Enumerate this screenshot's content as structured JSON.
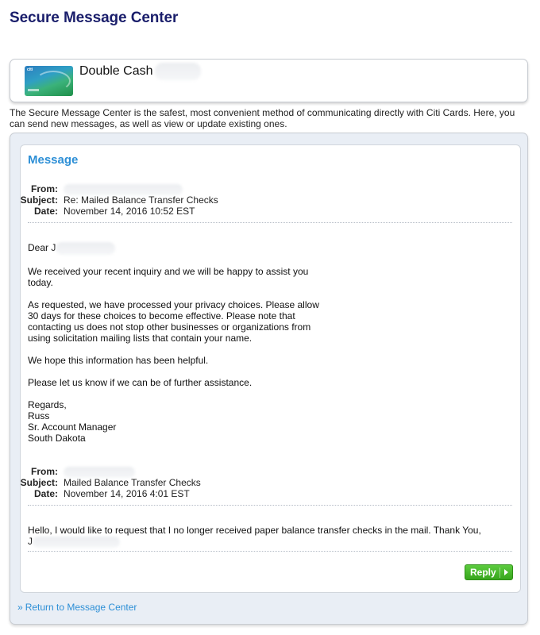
{
  "page": {
    "title": "Secure Message Center"
  },
  "card": {
    "name": "Double Cash",
    "image_logo": "citi"
  },
  "intro": "The Secure Message Center is the safest, most convenient method of communicating directly with Citi Cards. Here, you can send new messages, as well as view or update existing ones.",
  "message": {
    "heading": "Message",
    "labels": {
      "from": "From:",
      "subject": "Subject:",
      "date": "Date:"
    },
    "reply_meta": {
      "subject": "Re: Mailed Balance Transfer Checks",
      "date": "November 14, 2016 10:52 EST"
    },
    "reply_body": {
      "greeting": "Dear J",
      "p1": "We received your recent inquiry and we will be happy to assist you today.",
      "p2": "As requested, we have processed your privacy choices. Please allow 30 days for these choices to become effective. Please note that contacting us does not stop other businesses or organizations from using solicitation mailing lists that contain your name.",
      "p3": "We hope this information has been helpful.",
      "p4": "Please let us know if we can be of further assistance.",
      "sign_regards": "Regards,",
      "sign_name": "Russ",
      "sign_title": "Sr. Account Manager",
      "sign_location": "South Dakota"
    },
    "original_meta": {
      "subject": "Mailed Balance Transfer Checks",
      "date": "November 14, 2016 4:01 EST"
    },
    "original_body": {
      "text": "Hello, I would like to request that I no longer received paper balance transfer checks in the mail. Thank You,",
      "signature": "J"
    }
  },
  "actions": {
    "reply_label": "Reply",
    "return_chevron": "»",
    "return_label": "Return to Message Center"
  },
  "colors": {
    "title": "#1a1e6b",
    "link": "#2d8fd6",
    "reply_button": "#38a61d",
    "panel_background": "#e9eef5"
  }
}
